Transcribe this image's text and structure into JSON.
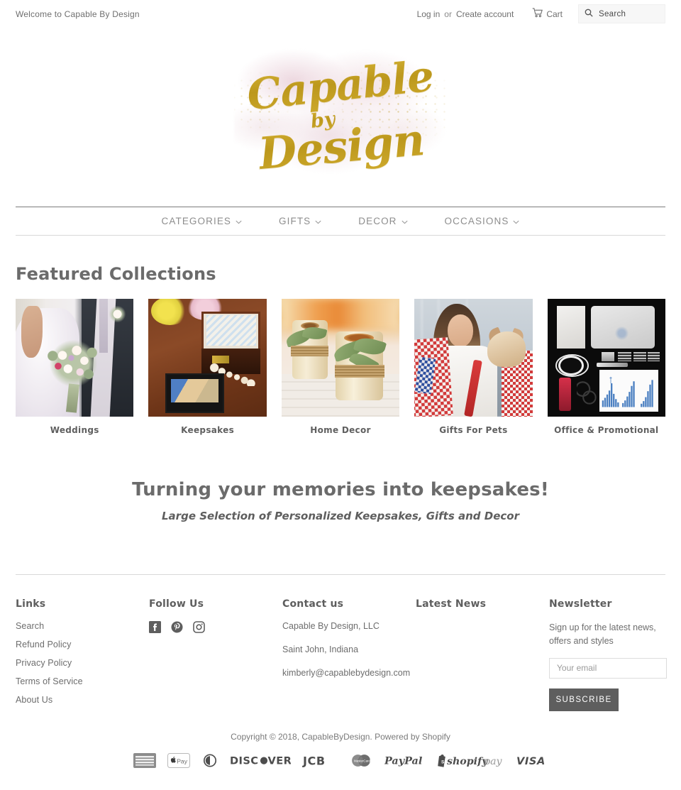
{
  "topbar": {
    "welcome": "Welcome to Capable By Design",
    "login_label": "Log in",
    "or_label": "or",
    "create_account_label": "Create account",
    "cart_label": "Cart",
    "search_placeholder": "Search",
    "search_value": ""
  },
  "logo": {
    "line1": "Capable",
    "line2": "by",
    "line3": "Design",
    "alt": "Capable By Design"
  },
  "nav": {
    "items": [
      {
        "label": "CATEGORIES",
        "icon": "chevron-down-icon"
      },
      {
        "label": "GIFTS",
        "icon": "chevron-down-icon"
      },
      {
        "label": "DECOR",
        "icon": "chevron-down-icon"
      },
      {
        "label": "OCCASIONS",
        "icon": "chevron-down-icon"
      }
    ]
  },
  "featured": {
    "title": "Featured Collections",
    "collections": [
      {
        "label": "Weddings"
      },
      {
        "label": "Keepsakes"
      },
      {
        "label": "Home Decor"
      },
      {
        "label": "Gifts For Pets"
      },
      {
        "label": "Office & Promotional"
      }
    ]
  },
  "tagline": {
    "heading": "Turning your memories into keepsakes!",
    "subheading": "Large Selection of Personalized Keepsakes, Gifts and Decor"
  },
  "footer": {
    "links": {
      "title": "Links",
      "items": [
        {
          "label": "Search"
        },
        {
          "label": "Refund Policy"
        },
        {
          "label": "Privacy Policy"
        },
        {
          "label": "Terms of Service"
        },
        {
          "label": "About Us"
        }
      ]
    },
    "follow": {
      "title": "Follow Us",
      "socials": [
        {
          "name": "facebook-icon"
        },
        {
          "name": "pinterest-icon"
        },
        {
          "name": "instagram-icon"
        }
      ]
    },
    "contact": {
      "title": "Contact us",
      "lines": [
        "Capable By Design, LLC",
        "Saint John, Indiana",
        "kimberly@capablebydesign.com"
      ]
    },
    "latest_news": {
      "title": "Latest News"
    },
    "newsletter": {
      "title": "Newsletter",
      "text": "Sign up for the latest news, offers and styles",
      "email_placeholder": "Your email",
      "email_value": "",
      "subscribe_label": "SUBSCRIBE"
    }
  },
  "bottom": {
    "copyright_prefix": "Copyright © 2018,",
    "store_name": "CapableByDesign.",
    "powered_by": "Powered by",
    "platform": "Shopify",
    "payments": [
      "american-express-icon",
      "apple-pay-icon",
      "diners-club-icon",
      "discover-icon",
      "jcb-icon",
      "master-icon",
      "paypal-icon",
      "shopify-pay-icon",
      "visa-icon"
    ]
  },
  "colors": {
    "text": "#6d6d6d",
    "heading": "#5e5e5e",
    "gold": "#c9a227",
    "button": "#5e5e5e",
    "rule": "#d8d8d8"
  }
}
